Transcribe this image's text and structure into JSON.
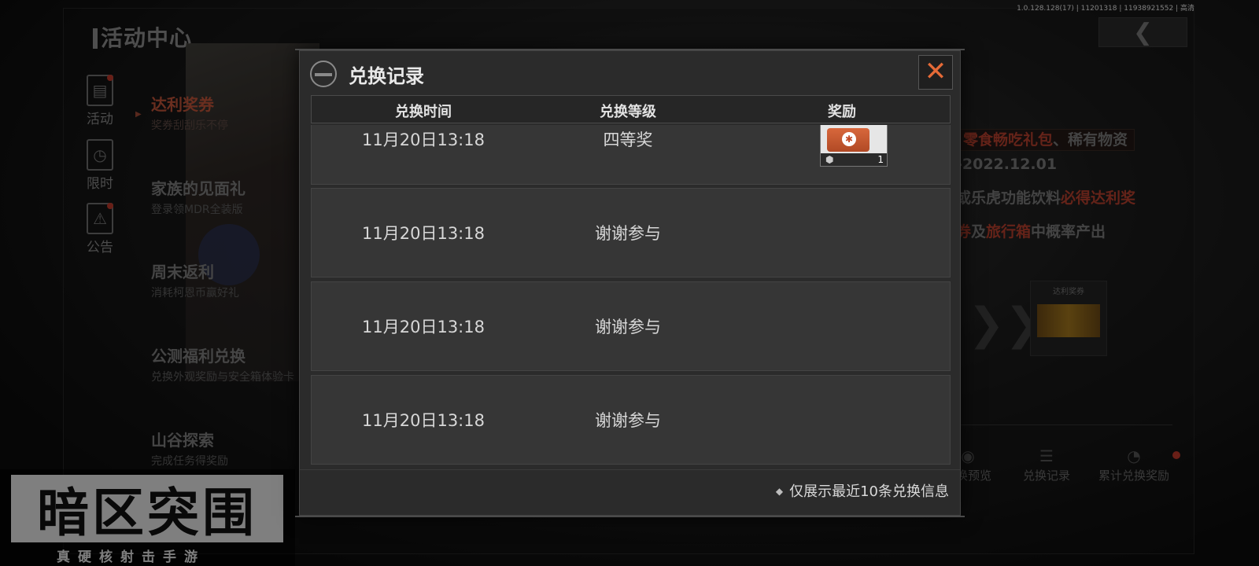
{
  "version_text": "1.0.128.128(17) | 11201318 | 11938921552 | 高清",
  "page_title": "活动中心",
  "vertical_tabs": [
    {
      "label": "活动",
      "icon": "clipboard-icon"
    },
    {
      "label": "限时",
      "icon": "clock-icon"
    },
    {
      "label": "公告",
      "icon": "warning-icon"
    }
  ],
  "menu": [
    {
      "title": "达利奖券",
      "subtitle": "奖券刮刮乐不停"
    },
    {
      "title": "家族的见面礼",
      "subtitle": "登录领MDR全装版"
    },
    {
      "title": "周末返利",
      "subtitle": "消耗柯恩币赢好礼"
    },
    {
      "title": "公测福利兑换",
      "subtitle": "兑换外观奖励与安全箱体验卡"
    },
    {
      "title": "山谷探索",
      "subtitle": "完成任务得奖励"
    }
  ],
  "right_panel": {
    "line1_a": "零食畅吃礼包",
    "line1_b": "、稀有物资",
    "line2": "-2022.12.01",
    "line3_a": "或乐虎功能饮料",
    "line3_b": "必得达利奖",
    "line4_a": "券",
    "line4_b": "及",
    "line4_c": "旅行箱",
    "line4_d": "中概率产出",
    "card_label": "达利奖券",
    "bottom_tabs": [
      "兑换预览",
      "兑换记录",
      "累计兑换奖励"
    ]
  },
  "logo": {
    "main": "暗区突围",
    "sub": "真硬核射击手游"
  },
  "dialog": {
    "title": "兑换记录",
    "close_label": "✕",
    "headers": {
      "time": "兑换时间",
      "level": "兑换等级",
      "reward": "奖励"
    },
    "records": [
      {
        "time": "11月20日13:18",
        "level": "四等奖",
        "reward_qty": "1",
        "reward_icon": "snack-pack-icon"
      },
      {
        "time": "11月20日13:18",
        "level": "谢谢参与"
      },
      {
        "time": "11月20日13:18",
        "level": "谢谢参与"
      },
      {
        "time": "11月20日13:18",
        "level": "谢谢参与"
      }
    ],
    "footer_note": "仅展示最近10条兑换信息"
  },
  "colors": {
    "accent": "#e56a37",
    "highlight_red": "#b8412f"
  }
}
